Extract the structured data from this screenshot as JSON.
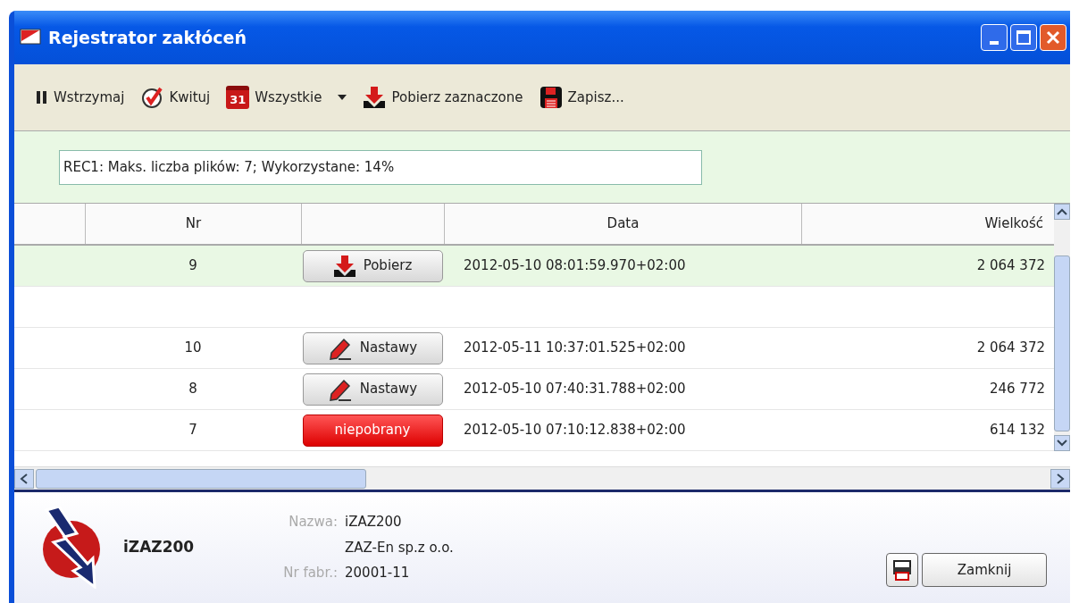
{
  "window": {
    "title": "Rejestrator zakłóceń"
  },
  "toolbar": [
    {
      "kind": "pause",
      "label": "Wstrzymaj"
    },
    {
      "kind": "acknowledge",
      "label": "Kwituj"
    },
    {
      "kind": "calendar",
      "label": "Wszystkie",
      "icon_text": "31",
      "dropdown": true
    },
    {
      "kind": "download",
      "label": "Pobierz zaznaczone"
    },
    {
      "kind": "save",
      "label": "Zapisz..."
    }
  ],
  "info": {
    "value": "REC1: Maks. liczba plików: 7; Wykorzystane: 14%"
  },
  "table": {
    "columns": [
      "Nr",
      "Data",
      "Wielkość"
    ],
    "rows": [
      {
        "kind": "record",
        "nr": "9",
        "action": {
          "kind": "download",
          "label": "Pobierz"
        },
        "date": "2012-05-10 08:01:59.970+02:00",
        "size": "2 064 372",
        "selected": true
      },
      {
        "kind": "spacer",
        "selected": false
      },
      {
        "kind": "record",
        "nr": "10",
        "action": {
          "kind": "settings",
          "label": "Nastawy"
        },
        "date": "2012-05-11 10:37:01.525+02:00",
        "size": "2 064 372",
        "selected": false
      },
      {
        "kind": "record",
        "nr": "8",
        "action": {
          "kind": "settings",
          "label": "Nastawy"
        },
        "date": "2012-05-10 07:40:31.788+02:00",
        "size": "246 772",
        "selected": false
      },
      {
        "kind": "record",
        "nr": "7",
        "action": {
          "kind": "missing",
          "label": "niepobrany"
        },
        "date": "2012-05-10 07:10:12.838+02:00",
        "size": "614 132",
        "selected": false
      }
    ]
  },
  "footer": {
    "device": "iZAZ200",
    "fields": [
      {
        "label": "Nazwa:",
        "value": "iZAZ200"
      },
      {
        "value": "ZAZ-En sp.z o.o."
      },
      {
        "label": "Nr fabr.:",
        "value": "20001-11"
      }
    ],
    "close_button": "Zamknij"
  }
}
